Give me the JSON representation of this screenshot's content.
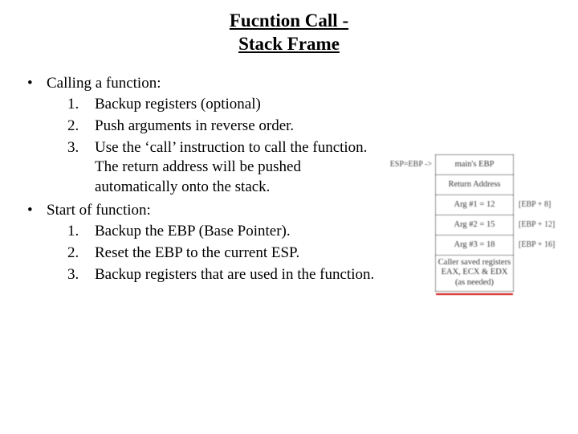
{
  "title_line1": "Fucntion Call -",
  "title_line2": "Stack Frame",
  "bullets": [
    {
      "lead": "Calling a function:",
      "items": [
        "Backup registers (optional)",
        "Push arguments in reverse order.",
        "Use the ‘call’ instruction to call the function. The return address will be pushed automatically onto the stack."
      ]
    },
    {
      "lead": "Start of function:",
      "items": [
        "Backup the EBP (Base Pointer).",
        "Reset the EBP to the current ESP.",
        "Backup registers that are used in the function."
      ]
    }
  ],
  "diagram": {
    "left_pointer": "ESP=EBP ->",
    "rows": [
      {
        "cell": "main's EBP",
        "right": ""
      },
      {
        "cell": "Return Address",
        "right": ""
      },
      {
        "cell": "Arg #1 = 12",
        "right": "[EBP + 8]"
      },
      {
        "cell": "Arg #2 = 15",
        "right": "[EBP + 12]"
      },
      {
        "cell": "Arg #3 = 18",
        "right": "[EBP + 16]"
      }
    ],
    "caller_saved_line1": "Caller saved registers",
    "caller_saved_line2": "EAX, ECX & EDX",
    "caller_saved_line3": "(as needed)"
  }
}
